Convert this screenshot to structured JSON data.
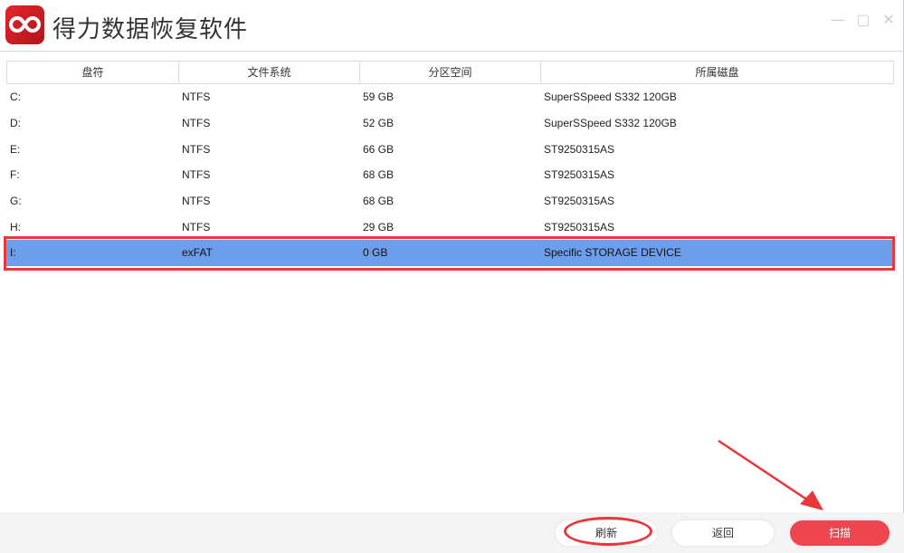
{
  "app": {
    "title": "得力数据恢复软件",
    "logo_colors": "#d2202a"
  },
  "window_controls": [
    "minimize-icon",
    "maximize-icon",
    "close-icon"
  ],
  "table": {
    "headers": [
      "盘符",
      "文件系统",
      "分区空间",
      "所属磁盘"
    ],
    "rows": [
      [
        "C:",
        "NTFS",
        "59 GB",
        "SuperSSpeed S332 120GB"
      ],
      [
        "D:",
        "NTFS",
        "52 GB",
        "SuperSSpeed S332 120GB"
      ],
      [
        "E:",
        "NTFS",
        "66 GB",
        "ST9250315AS"
      ],
      [
        "F:",
        "NTFS",
        "68 GB",
        "ST9250315AS"
      ],
      [
        "G:",
        "NTFS",
        "68 GB",
        "ST9250315AS"
      ],
      [
        "H:",
        "NTFS",
        "29 GB",
        "ST9250315AS"
      ],
      [
        "I:",
        "exFAT",
        "0 GB",
        "Specific STORAGE DEVICE"
      ]
    ],
    "selected_index": 6
  },
  "buttons": {
    "refresh": "刷新",
    "back": "返回",
    "scan": "扫描"
  },
  "colors": {
    "selection": "#6d9eec",
    "accent": "#ee4650",
    "annotation": "#e8383d"
  }
}
